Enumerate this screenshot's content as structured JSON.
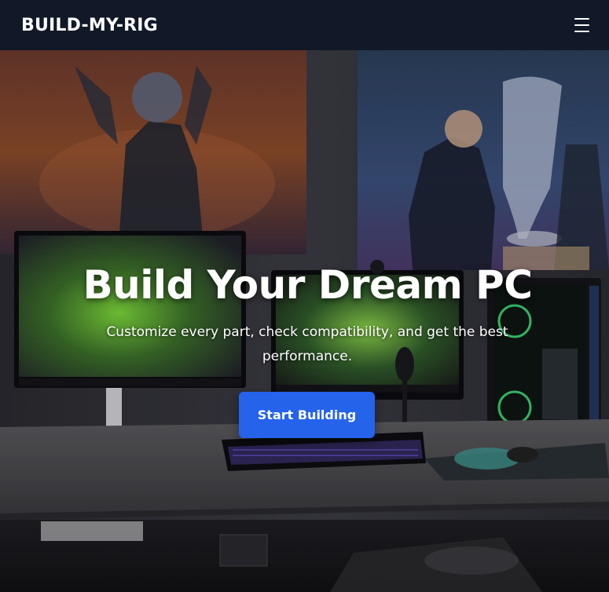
{
  "navbar": {
    "brand": "BUILD-MY-RIG",
    "menu_icon": "hamburger-menu-icon"
  },
  "hero": {
    "background": "photo of a gaming setup with monitors, keyboard, PC tower and esports posters",
    "title": "Build Your Dream PC",
    "subtitle": "Customize every part, check compatibility, and get the best performance.",
    "cta_label": "Start Building"
  },
  "colors": {
    "navbar_bg": "#111827",
    "accent": "#2563eb",
    "text": "#ffffff"
  }
}
